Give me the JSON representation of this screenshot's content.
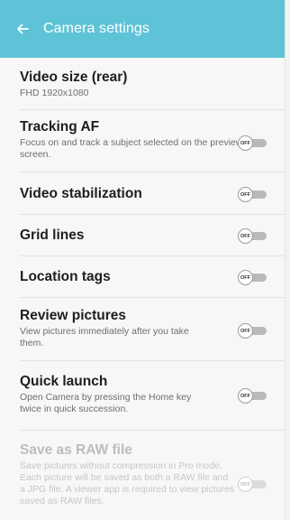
{
  "header": {
    "back_icon": "arrow-left-icon",
    "title": "Camera settings",
    "background": "#5ec3d6"
  },
  "settings": [
    {
      "label": "Video size (rear)",
      "sub": "FHD 1920x1080"
    },
    {
      "label": "Tracking AF",
      "sub": "Focus on and track a subject selected on the preview screen.",
      "toggle": "OFF"
    },
    {
      "label": "Video stabilization",
      "toggle": "OFF"
    },
    {
      "label": "Grid lines",
      "toggle": "OFF"
    },
    {
      "label": "Location tags",
      "toggle": "OFF"
    },
    {
      "label": "Review pictures",
      "sub": "View pictures immediately after you take them.",
      "toggle": "OFF"
    },
    {
      "label": "Quick launch",
      "sub": "Open Camera by pressing the Home key twice in quick succession.",
      "toggle": "OFF"
    },
    {
      "label": "Save as RAW file",
      "sub": "Save pictures without compression in Pro mode. Each picture will be saved as both a RAW file and a JPG file. A viewer app is required to view pictures saved as RAW files.",
      "toggle": "OFF",
      "disabled": true
    }
  ]
}
